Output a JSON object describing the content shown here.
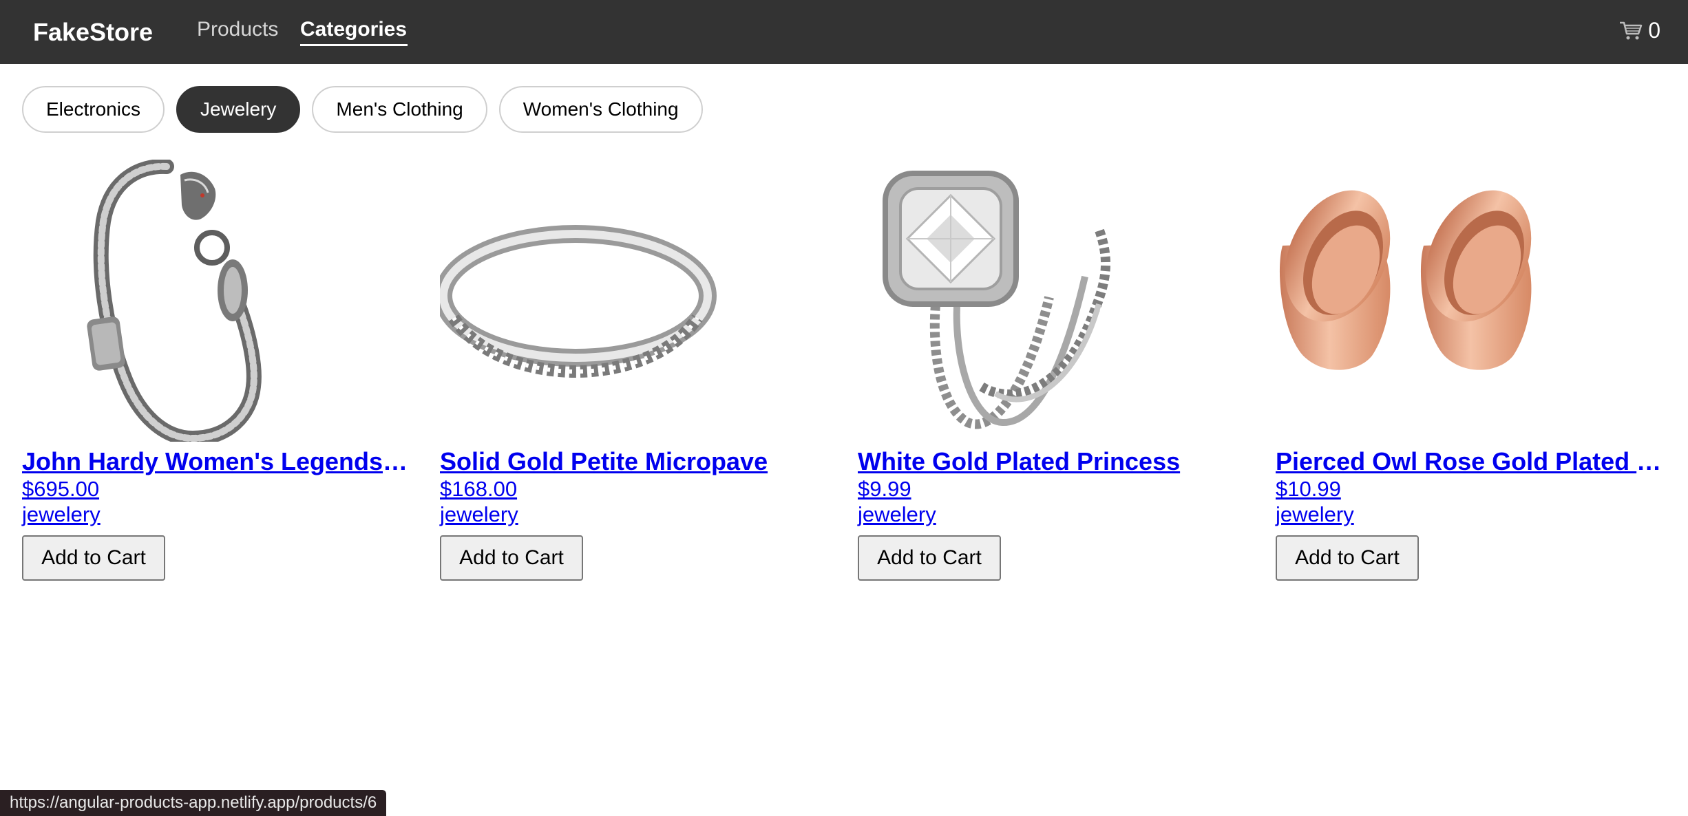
{
  "header": {
    "brand": "FakeStore",
    "nav": {
      "products": "Products",
      "categories": "Categories"
    },
    "cart_count": "0",
    "cart_icon": "cart-icon"
  },
  "categories": [
    "Electronics",
    "Jewelery",
    "Men's Clothing",
    "Women's Clothing"
  ],
  "selected_category": "Jewelery",
  "products": [
    {
      "title": "John Hardy Women's Legends Naga Gold & Silver Dragon Station Chain Bracelet",
      "price": "$695.00",
      "category": "jewelery",
      "button": "Add to Cart",
      "image": "silver-dragon-bracelet"
    },
    {
      "title": "Solid Gold Petite Micropave",
      "price": "$168.00",
      "category": "jewelery",
      "button": "Add to Cart",
      "image": "silver-micropave-ring"
    },
    {
      "title": "White Gold Plated Princess",
      "price": "$9.99",
      "category": "jewelery",
      "button": "Add to Cart",
      "image": "diamond-ring-set"
    },
    {
      "title": "Pierced Owl Rose Gold Plated Stainless Steel Double",
      "price": "$10.99",
      "category": "jewelery",
      "button": "Add to Cart",
      "image": "rose-gold-tunnel-plugs"
    }
  ],
  "status_url": "https://angular-products-app.netlify.app/products/6",
  "colors": {
    "header_bg": "#333333",
    "link": "#0000ee",
    "active_chip": "#333333",
    "rose_gold": "#e0a080"
  }
}
